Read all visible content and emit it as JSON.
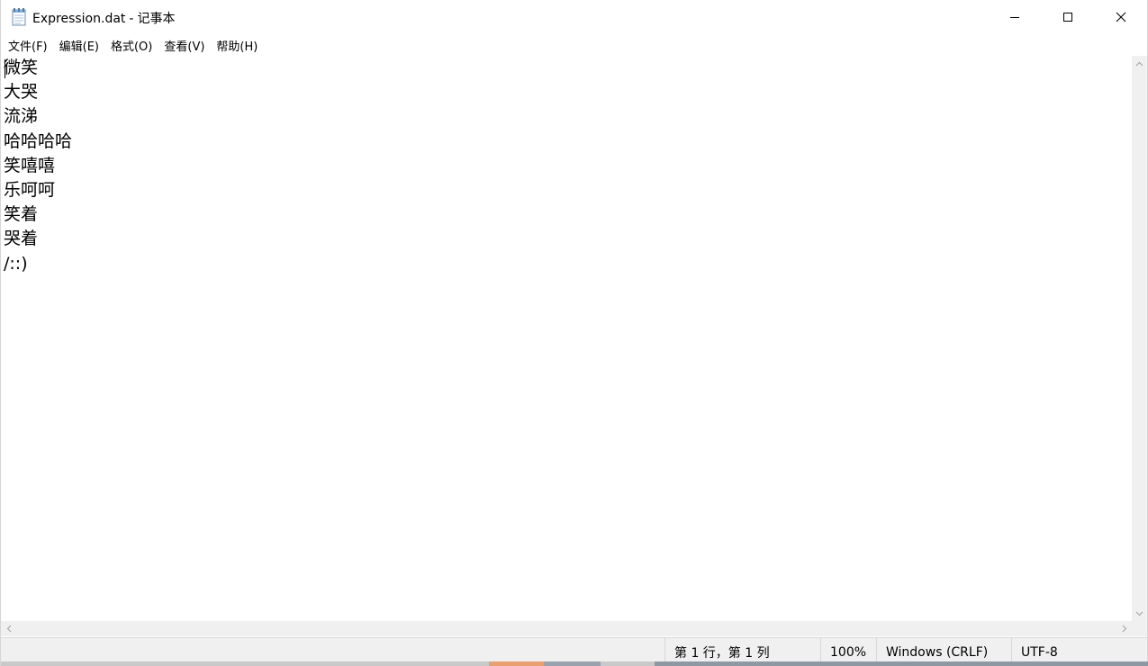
{
  "window": {
    "file_name": "Expression.dat",
    "separator": "-",
    "app_name": "记事本"
  },
  "menu": {
    "items": [
      {
        "label": "文件(F)"
      },
      {
        "label": "编辑(E)"
      },
      {
        "label": "格式(O)"
      },
      {
        "label": "查看(V)"
      },
      {
        "label": "帮助(H)"
      }
    ]
  },
  "editor": {
    "lines": [
      "微笑",
      "大哭",
      "流涕",
      "哈哈哈哈",
      "笑嘻嘻",
      "乐呵呵",
      "笑着",
      "哭着",
      "/::)"
    ]
  },
  "status": {
    "position": "第 1 行，第 1 列",
    "zoom": "100%",
    "line_ending": "Windows (CRLF)",
    "encoding": "UTF-8"
  },
  "icons": {
    "app": "notepad-icon",
    "minimize": "minimize-icon",
    "maximize": "maximize-icon",
    "close": "close-icon"
  },
  "colors": {
    "background": "#ffffff",
    "statusbar": "#f0f0f0",
    "text": "#000000"
  }
}
